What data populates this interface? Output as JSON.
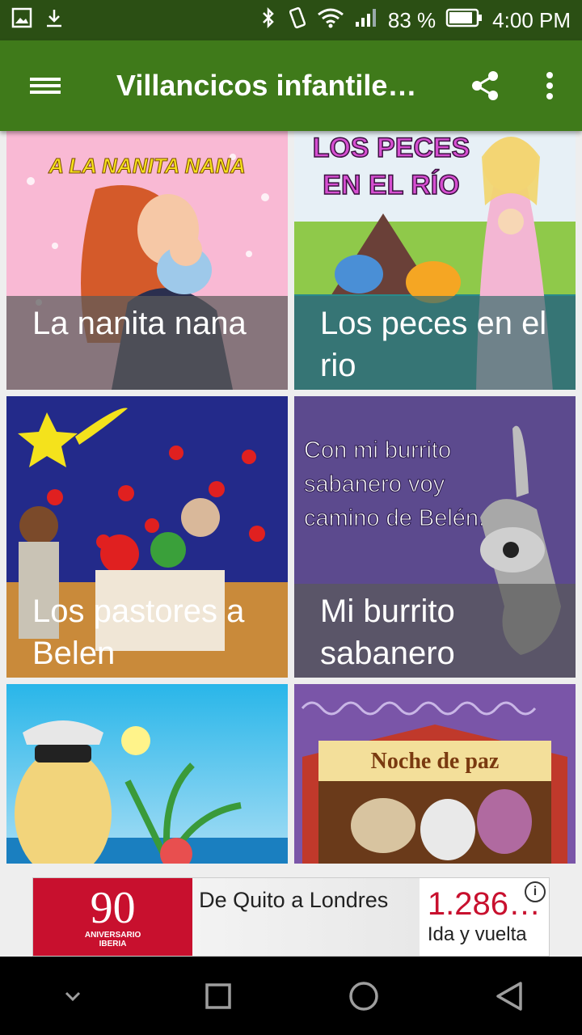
{
  "status_bar": {
    "battery": "83 %",
    "time": "4:00 PM"
  },
  "app_bar": {
    "title": "Villancicos infantile…"
  },
  "cards": [
    {
      "title": "La nanita nana",
      "art_text": "A LA NANITA NANA"
    },
    {
      "title": "Los peces en el rio",
      "art_text": "LOS PECES EN EL RÍO"
    },
    {
      "title": "Los pastores a Belen",
      "art_text": ""
    },
    {
      "title": "Mi burrito sabanero",
      "art_text": "Con mi burrito sabanero voy camino de Belén."
    },
    {
      "title": "",
      "art_text": ""
    },
    {
      "title": "",
      "art_text": "Noche de paz"
    }
  ],
  "ad": {
    "logo_number": "90",
    "logo_sub1": "ANIVERSARIO",
    "logo_sub2": "IBERIA",
    "headline": "De Quito a Londres",
    "price": "1.286…",
    "price_sub": "Ida y vuelta"
  },
  "colors": {
    "status_bar": "#2b4f14",
    "app_bar": "#3f7a1a",
    "ad_brand": "#c8102e"
  }
}
